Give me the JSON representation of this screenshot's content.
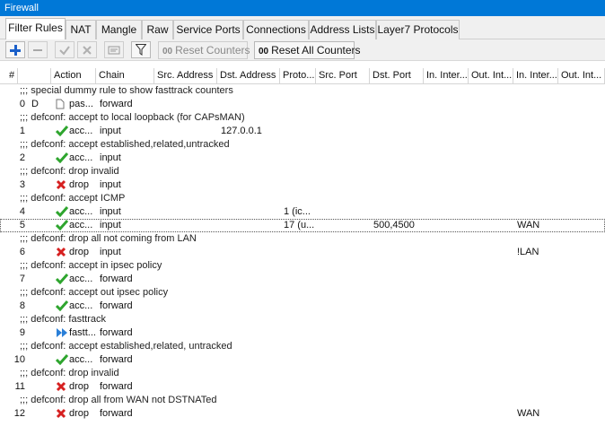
{
  "window": {
    "title": "Firewall"
  },
  "tabs": [
    "Filter Rules",
    "NAT",
    "Mangle",
    "Raw",
    "Service Ports",
    "Connections",
    "Address Lists",
    "Layer7 Protocols"
  ],
  "toolbar": {
    "reset_counters_label": "Reset Counters",
    "reset_all_counters_label": "Reset All Counters",
    "counter_badge": "00"
  },
  "table": {
    "columns": [
      "#",
      "Action",
      "Chain",
      "Src. Address",
      "Dst. Address",
      "Proto...",
      "Src. Port",
      "Dst. Port",
      "In. Inter...",
      "Out. Int...",
      "In. Inter...",
      "Out. Int..."
    ],
    "rows": [
      {
        "type": "comment",
        "text": ";;; special dummy rule to show fasttrack counters"
      },
      {
        "type": "rule",
        "num": "0",
        "flag": "D",
        "action_icon": "passthrough-icon",
        "action": "pas...",
        "chain": "forward",
        "dst": "",
        "proto": "",
        "dport": "",
        "in_list": ""
      },
      {
        "type": "comment",
        "text": ";;; defconf: accept to local loopback (for CAPsMAN)"
      },
      {
        "type": "rule",
        "num": "1",
        "flag": "",
        "action_icon": "accept-icon",
        "action": "acc...",
        "chain": "input",
        "dst": "127.0.0.1",
        "proto": "",
        "dport": "",
        "in_list": ""
      },
      {
        "type": "comment",
        "text": ";;; defconf: accept established,related,untracked"
      },
      {
        "type": "rule",
        "num": "2",
        "flag": "",
        "action_icon": "accept-icon",
        "action": "acc...",
        "chain": "input",
        "dst": "",
        "proto": "",
        "dport": "",
        "in_list": ""
      },
      {
        "type": "comment",
        "text": ";;; defconf: drop invalid"
      },
      {
        "type": "rule",
        "num": "3",
        "flag": "",
        "action_icon": "drop-icon",
        "action": "drop",
        "chain": "input",
        "dst": "",
        "proto": "",
        "dport": "",
        "in_list": ""
      },
      {
        "type": "comment",
        "text": ";;; defconf: accept ICMP"
      },
      {
        "type": "rule",
        "num": "4",
        "flag": "",
        "action_icon": "accept-icon",
        "action": "acc...",
        "chain": "input",
        "dst": "",
        "proto": "1 (ic...",
        "dport": "",
        "in_list": ""
      },
      {
        "type": "rule",
        "num": "5",
        "flag": "",
        "action_icon": "accept-icon",
        "action": "acc...",
        "chain": "input",
        "dst": "",
        "proto": "17 (u...",
        "dport": "500,4500",
        "in_list": "WAN",
        "selected": true
      },
      {
        "type": "comment",
        "text": ";;; defconf: drop all not coming from LAN"
      },
      {
        "type": "rule",
        "num": "6",
        "flag": "",
        "action_icon": "drop-icon",
        "action": "drop",
        "chain": "input",
        "dst": "",
        "proto": "",
        "dport": "",
        "in_list": "!LAN"
      },
      {
        "type": "comment",
        "text": ";;; defconf: accept in ipsec policy"
      },
      {
        "type": "rule",
        "num": "7",
        "flag": "",
        "action_icon": "accept-icon",
        "action": "acc...",
        "chain": "forward",
        "dst": "",
        "proto": "",
        "dport": "",
        "in_list": ""
      },
      {
        "type": "comment",
        "text": ";;; defconf: accept out ipsec policy"
      },
      {
        "type": "rule",
        "num": "8",
        "flag": "",
        "action_icon": "accept-icon",
        "action": "acc...",
        "chain": "forward",
        "dst": "",
        "proto": "",
        "dport": "",
        "in_list": ""
      },
      {
        "type": "comment",
        "text": ";;; defconf: fasttrack"
      },
      {
        "type": "rule",
        "num": "9",
        "flag": "",
        "action_icon": "fasttrack-icon",
        "action": "fastt...",
        "chain": "forward",
        "dst": "",
        "proto": "",
        "dport": "",
        "in_list": ""
      },
      {
        "type": "comment",
        "text": ";;; defconf: accept established,related, untracked"
      },
      {
        "type": "rule",
        "num": "10",
        "flag": "",
        "action_icon": "accept-icon",
        "action": "acc...",
        "chain": "forward",
        "dst": "",
        "proto": "",
        "dport": "",
        "in_list": ""
      },
      {
        "type": "comment",
        "text": ";;; defconf: drop invalid"
      },
      {
        "type": "rule",
        "num": "11",
        "flag": "",
        "action_icon": "drop-icon",
        "action": "drop",
        "chain": "forward",
        "dst": "",
        "proto": "",
        "dport": "",
        "in_list": ""
      },
      {
        "type": "comment",
        "text": ";;; defconf: drop all from WAN not DSTNATed"
      },
      {
        "type": "rule",
        "num": "12",
        "flag": "",
        "action_icon": "drop-icon",
        "action": "drop",
        "chain": "forward",
        "dst": "",
        "proto": "",
        "dport": "",
        "in_list": "WAN"
      }
    ]
  },
  "colors": {
    "titlebar": "#0078d7",
    "accept": "#2ea52e",
    "drop": "#d62020",
    "fasttrack": "#2a7fd8",
    "add": "#1a5fc9"
  }
}
